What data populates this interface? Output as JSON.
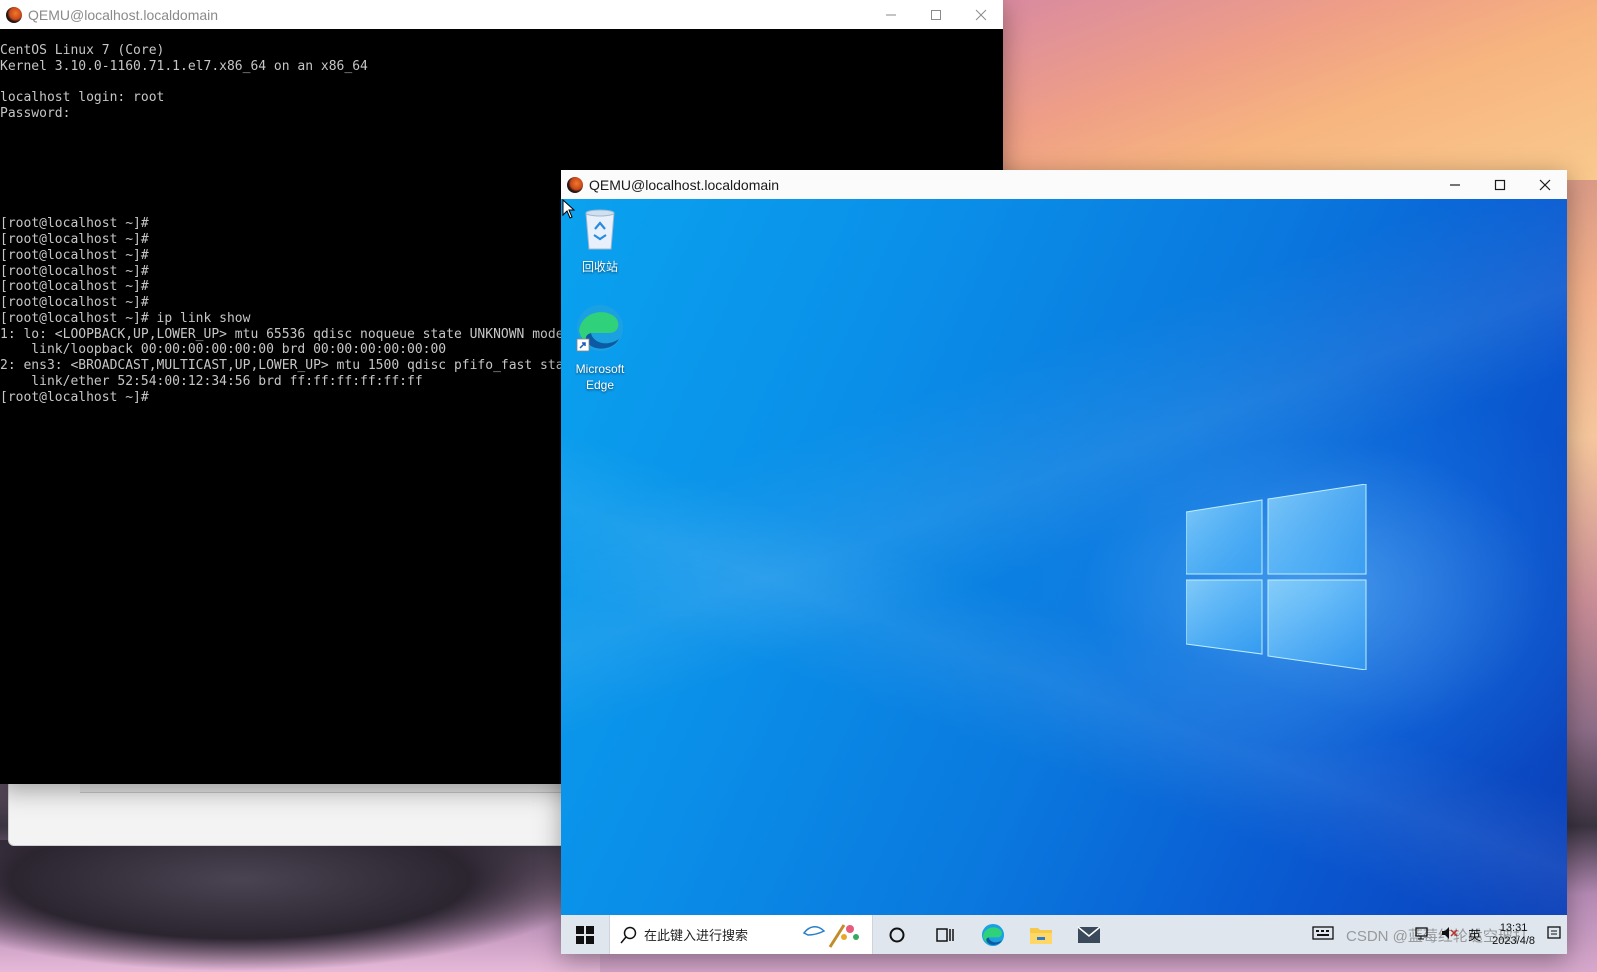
{
  "windows": {
    "terminal": {
      "title": "QEMU@localhost.localdomain",
      "lines": [
        "CentOS Linux 7 (Core)",
        "Kernel 3.10.0-1160.71.1.el7.x86_64 on an x86_64",
        "",
        "localhost login: root",
        "Password:",
        "",
        "",
        "",
        "",
        "",
        "",
        "[root@localhost ~]#",
        "[root@localhost ~]#",
        "[root@localhost ~]#",
        "[root@localhost ~]#",
        "[root@localhost ~]#",
        "[root@localhost ~]#",
        "[root@localhost ~]# ip link show",
        "1: lo: <LOOPBACK,UP,LOWER_UP> mtu 65536 qdisc noqueue state UNKNOWN mode",
        "    link/loopback 00:00:00:00:00:00 brd 00:00:00:00:00:00",
        "2: ens3: <BROADCAST,MULTICAST,UP,LOWER_UP> mtu 1500 qdisc pfifo_fast sta",
        "    link/ether 52:54:00:12:34:56 brd ff:ff:ff:ff:ff:ff",
        "[root@localhost ~]#"
      ]
    },
    "vm": {
      "title": "QEMU@localhost.localdomain",
      "desktop_icons": [
        {
          "label": "回收站",
          "icon": "recycle-bin-icon"
        },
        {
          "label": "Microsoft Edge",
          "icon": "edge-icon"
        }
      ],
      "taskbar": {
        "search_placeholder": "在此键入进行搜索",
        "tray_input": "英",
        "time": "13:31",
        "date": "2023/4/8",
        "watermark": "CSDN @蓝莓红轮哒空玻打"
      }
    }
  },
  "colors": {
    "vm_desktop": "#0a78de",
    "terminal_bg": "#000000",
    "terminal_fg": "#c6c6c6",
    "taskbar": "#dfe6ee"
  }
}
